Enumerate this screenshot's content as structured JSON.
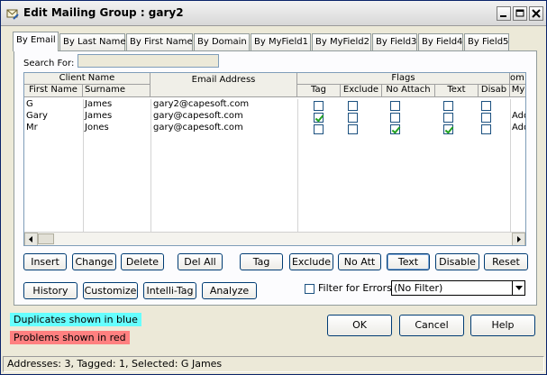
{
  "window": {
    "title": "Edit Mailing Group : gary2"
  },
  "tabs": [
    "By Email",
    "By Last Name",
    "By First Name",
    "By Domain",
    "By MyField1",
    "By MyField2",
    "By Field3",
    "By Field4",
    "By Field5"
  ],
  "search": {
    "label": "Search For:",
    "value": ""
  },
  "columns": {
    "client_name": "Client Name",
    "first_name": "First Name",
    "surname": "Surname",
    "email": "Email Address",
    "flags": "Flags",
    "tag": "Tag",
    "exclude": "Exclude",
    "no_attach": "No Attach",
    "text": "Text",
    "disable": "Disab",
    "custom_top": "om I",
    "custom_sub": "My"
  },
  "rows": [
    {
      "first": "G",
      "surname": "James",
      "email": "gary2@capesoft.com",
      "tag": false,
      "exclude": false,
      "no_attach": false,
      "text": false,
      "disable": false,
      "custom": ""
    },
    {
      "first": "Gary",
      "surname": "James",
      "email": "gary@capesoft.com",
      "tag": true,
      "exclude": false,
      "no_attach": false,
      "text": false,
      "disable": false,
      "custom": "Add"
    },
    {
      "first": "Mr",
      "surname": "Jones",
      "email": "gary@capesoft.com",
      "tag": false,
      "exclude": false,
      "no_attach": true,
      "text": true,
      "disable": false,
      "custom": "Add"
    }
  ],
  "buttons": {
    "insert": "Insert",
    "change": "Change",
    "delete": "Delete",
    "del_all": "Del All",
    "tag": "Tag",
    "exclude": "Exclude",
    "no_att": "No Att",
    "text": "Text",
    "disable": "Disable",
    "reset": "Reset",
    "history": "History",
    "customize": "Customize",
    "intelli_tag": "Intelli-Tag",
    "analyze": "Analyze",
    "ok": "OK",
    "cancel": "Cancel",
    "help": "Help"
  },
  "filter": {
    "label": "Filter for Errors",
    "checked": false,
    "selected": "(No Filter)"
  },
  "legend": {
    "duplicates": "Duplicates shown in blue",
    "duplicates_color": "#66ffff",
    "problems": "Problems shown in red",
    "problems_color": "#ff8080"
  },
  "status": "Addresses: 3, Tagged: 1, Selected: G James",
  "icons": {
    "app": "mail-edit-icon",
    "minimize": "minimize-icon",
    "maximize": "maximize-icon",
    "close": "close-icon",
    "left": "scroll-left-icon",
    "right": "scroll-right-icon",
    "dropdown": "chevron-down-icon"
  }
}
